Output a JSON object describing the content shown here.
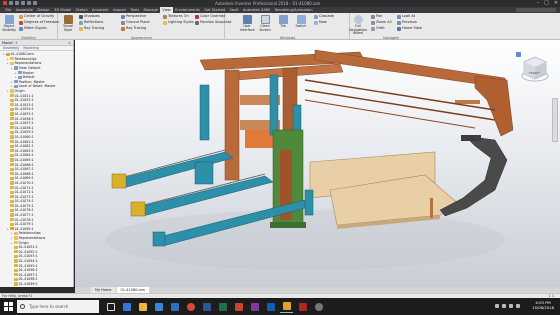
{
  "window": {
    "title": "Autodesk Inventor Professional 2018 - 01-41080.iam"
  },
  "ribbon_tabs": [
    "File",
    "Assemble",
    "Design",
    "3D Model",
    "Sketch",
    "Annotate",
    "Inspect",
    "Tools",
    "Manage",
    "View",
    "Environments",
    "Get Started",
    "Vault",
    "Autodesk A360",
    "Rendering/Animation"
  ],
  "active_tab": "View",
  "ribbon": {
    "visibility": {
      "label": "Visibility",
      "big": "Object Visibility",
      "items": [
        "Center of Gravity",
        "Degrees of Freedom",
        "iMate Glyphs"
      ]
    },
    "appearance": {
      "label": "Appearance",
      "big": "Visual Style",
      "col1": [
        "Shadows",
        "Reflections",
        "Ray Tracing"
      ],
      "col2": [
        "Perspective",
        "Ground Plane",
        "Ray Tracing"
      ],
      "col3": [
        "Textures On",
        "Lighting Styles"
      ],
      "col4": [
        "Color Override",
        "Parallax Snapshot"
      ]
    },
    "windows": {
      "label": "Windows",
      "items": [
        "Clean Screen",
        "Cascade",
        "Tile",
        "Arrange",
        "New",
        "Switch",
        "Tab",
        "User Interface"
      ]
    },
    "navigate": {
      "label": "Navigate",
      "big": "Full Navigation Wheel",
      "items": [
        "Pan",
        "Zoom All",
        "Orbit",
        "Look At",
        "Previous",
        "Home View"
      ]
    }
  },
  "browser": {
    "header": "Model",
    "tabs": [
      "Assembly",
      "Modeling"
    ],
    "nodes": [
      {
        "text": "01-41080.iam",
        "depth": 0,
        "icon": "assembly"
      },
      {
        "text": "Relationships",
        "depth": 1,
        "icon": "folder"
      },
      {
        "text": "Representations",
        "depth": 1,
        "icon": "folder"
      },
      {
        "text": "View: Default",
        "depth": 2,
        "icon": "view"
      },
      {
        "text": "Master",
        "depth": 3,
        "icon": "view"
      },
      {
        "text": "Default",
        "depth": 3,
        "icon": "view"
      },
      {
        "text": "Position: Master",
        "depth": 2,
        "icon": "view"
      },
      {
        "text": "Level of Detail: Master",
        "depth": 2,
        "icon": "view"
      },
      {
        "text": "Origin",
        "depth": 1,
        "icon": "folder"
      },
      {
        "text": "01-41051:1",
        "depth": 1,
        "icon": "part"
      },
      {
        "text": "01-41052:1",
        "depth": 1,
        "icon": "part"
      },
      {
        "text": "01-41053:1",
        "depth": 1,
        "icon": "part"
      },
      {
        "text": "01-41054:1",
        "depth": 1,
        "icon": "part"
      },
      {
        "text": "01-41055:1",
        "depth": 1,
        "icon": "part"
      },
      {
        "text": "01-41056:1",
        "depth": 1,
        "icon": "part"
      },
      {
        "text": "01-41057:1",
        "depth": 1,
        "icon": "part"
      },
      {
        "text": "01-41058:1",
        "depth": 1,
        "icon": "part"
      },
      {
        "text": "01-41059:1",
        "depth": 1,
        "icon": "part"
      },
      {
        "text": "01-41060:1",
        "depth": 1,
        "icon": "part"
      },
      {
        "text": "01-41061:1",
        "depth": 1,
        "icon": "part"
      },
      {
        "text": "01-41062:1",
        "depth": 1,
        "icon": "part"
      },
      {
        "text": "01-41063:1",
        "depth": 1,
        "icon": "part"
      },
      {
        "text": "01-41064:1",
        "depth": 1,
        "icon": "part"
      },
      {
        "text": "01-41065:1",
        "depth": 1,
        "icon": "part"
      },
      {
        "text": "01-41066:1",
        "depth": 1,
        "icon": "part"
      },
      {
        "text": "01-41067:1",
        "depth": 1,
        "icon": "part"
      },
      {
        "text": "01-41068:1",
        "depth": 1,
        "icon": "part"
      },
      {
        "text": "01-41069:1",
        "depth": 1,
        "icon": "part"
      },
      {
        "text": "01-41070:1",
        "depth": 1,
        "icon": "part"
      },
      {
        "text": "01-41071:1",
        "depth": 1,
        "icon": "part"
      },
      {
        "text": "01-41072:1",
        "depth": 1,
        "icon": "part"
      },
      {
        "text": "01-41073:1",
        "depth": 1,
        "icon": "part"
      },
      {
        "text": "01-41074:1",
        "depth": 1,
        "icon": "part"
      },
      {
        "text": "01-41075:1",
        "depth": 1,
        "icon": "part"
      },
      {
        "text": "01-41076:1",
        "depth": 1,
        "icon": "part"
      },
      {
        "text": "01-41077:1",
        "depth": 1,
        "icon": "part"
      },
      {
        "text": "01-41078:1",
        "depth": 1,
        "icon": "part"
      },
      {
        "text": "01-41079:1",
        "depth": 1,
        "icon": "part"
      },
      {
        "text": "01-41090:1",
        "depth": 1,
        "icon": "assembly"
      },
      {
        "text": "Relationships",
        "depth": 2,
        "icon": "folder"
      },
      {
        "text": "Representations",
        "depth": 2,
        "icon": "folder"
      },
      {
        "text": "Origin",
        "depth": 2,
        "icon": "folder"
      },
      {
        "text": "01-41091:1",
        "depth": 2,
        "icon": "part"
      },
      {
        "text": "01-41092:1",
        "depth": 2,
        "icon": "part"
      },
      {
        "text": "01-41093:1",
        "depth": 2,
        "icon": "part"
      },
      {
        "text": "01-41094:1",
        "depth": 2,
        "icon": "part"
      },
      {
        "text": "01-41095:1",
        "depth": 2,
        "icon": "part"
      },
      {
        "text": "01-41096:1",
        "depth": 2,
        "icon": "part"
      },
      {
        "text": "01-41097:1",
        "depth": 2,
        "icon": "part"
      },
      {
        "text": "01-41098:1",
        "depth": 2,
        "icon": "part"
      },
      {
        "text": "01-41099:1",
        "depth": 2,
        "icon": "part"
      }
    ]
  },
  "viewcube": {
    "face_label": "FRONT"
  },
  "doc_tabs": [
    "My Home",
    "01-41080.iam"
  ],
  "active_doc_tab": "01-41080.iam",
  "status": {
    "left": "For Help, press F1",
    "right": "1   1"
  },
  "taskbar": {
    "search_placeholder": "Type here to search",
    "time": "4:03 PM",
    "date": "15/08/2018"
  },
  "colors": {
    "wood": "#b86a3a",
    "teal": "#2e8fa8",
    "green": "#4f8a3c",
    "dark": "#4a4a4a",
    "plate": "#e8cfa5"
  }
}
